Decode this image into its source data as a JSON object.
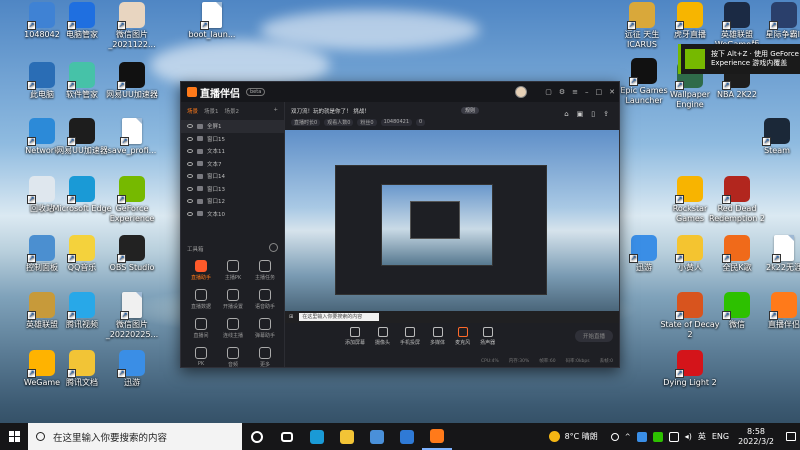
{
  "desktop": {
    "left_icons": [
      {
        "label": "1048042",
        "color": "#3f82d4"
      },
      {
        "label": "电脑管家",
        "color": "#1f6fe0"
      },
      {
        "label": "微信图片_2021122...",
        "color": "#e8d5c0"
      },
      {
        "label": "boot_laun...",
        "color": "#ffffff"
      },
      {
        "label": "此电脑",
        "color": "#2a6db5"
      },
      {
        "label": "软件管家",
        "color": "#46c2a8"
      },
      {
        "label": "网易UU加速器",
        "color": "#111111"
      },
      {
        "label": "Network",
        "color": "#2c8ad8"
      },
      {
        "label": "网易UU加速器",
        "color": "#1d1d1d"
      },
      {
        "label": "save_profi...",
        "color": "#ffffff"
      },
      {
        "label": "回收站",
        "color": "#dfe7ee"
      },
      {
        "label": "Microsoft Edge",
        "color": "#1a9ad6"
      },
      {
        "label": "GeForce Experience",
        "color": "#76b900"
      },
      {
        "label": "控制面板",
        "color": "#4b8fd0"
      },
      {
        "label": "QQ音乐",
        "color": "#f4d23c"
      },
      {
        "label": "OBS Studio",
        "color": "#222222"
      },
      {
        "label": "英雄联盟",
        "color": "#c79a3a"
      },
      {
        "label": "腾讯视频",
        "color": "#28a8e8"
      },
      {
        "label": "微信图片_20220225...",
        "color": "#f0f0f0"
      },
      {
        "label": "WeGame",
        "color": "#ffb300"
      },
      {
        "label": "腾讯文档",
        "color": "#f2c436"
      },
      {
        "label": "迅游",
        "color": "#3a8ee6"
      }
    ],
    "right_icons": [
      {
        "label": "远征 天生ICARUS",
        "color": "#d9a83a"
      },
      {
        "label": "虎牙直播",
        "color": "#f7b500"
      },
      {
        "label": "英雄联盟WeGame版",
        "color": "#1b2a44"
      },
      {
        "label": "星际争霸II",
        "color": "#2a3f6b"
      },
      {
        "label": "Epic Games Launcher",
        "color": "#111111"
      },
      {
        "label": "Wallpaper Engine",
        "color": "#2f6b4a"
      },
      {
        "label": "NBA 2K22",
        "color": "#1d1d1d"
      },
      {
        "label": "Steam",
        "color": "#1b2838"
      },
      {
        "label": "Rockstar Games",
        "color": "#f8b400"
      },
      {
        "label": "Red Dead Redemption 2",
        "color": "#b2261e"
      },
      {
        "label": "迅游",
        "color": "#3a8ee6"
      },
      {
        "label": "小黄人",
        "color": "#f4c430"
      },
      {
        "label": "全民K歌",
        "color": "#f06a1a"
      },
      {
        "label": "2k22无涯",
        "color": "#ffffff"
      },
      {
        "label": "State of Decay 2",
        "color": "#d8541e"
      },
      {
        "label": "微信",
        "color": "#2dc100"
      },
      {
        "label": "直播伴侣",
        "color": "#ff7a1a"
      },
      {
        "label": "Dying Light 2",
        "color": "#d4141a"
      }
    ]
  },
  "geforce_popup": {
    "text": "按下 Alt+Z · 使用 GeForce Experience 游戏内覆盖"
  },
  "app": {
    "title": "直播伴侣",
    "version": "beta",
    "source_tabs": [
      "场景",
      "场景1",
      "场景2"
    ],
    "sources": [
      {
        "name": "全屏1"
      },
      {
        "name": "窗口15"
      },
      {
        "name": "文本11"
      },
      {
        "name": "文本7"
      },
      {
        "name": "窗口14"
      },
      {
        "name": "窗口13"
      },
      {
        "name": "窗口12"
      },
      {
        "name": "文本10"
      }
    ],
    "tools_header": "工具箱",
    "tools": [
      {
        "label": "直播助手"
      },
      {
        "label": "主播PK"
      },
      {
        "label": "主播任务"
      },
      {
        "label": "直播数据"
      },
      {
        "label": "开播设置"
      },
      {
        "label": "语音助手"
      },
      {
        "label": "直播间"
      },
      {
        "label": "连线主播"
      },
      {
        "label": "弹幕助手"
      },
      {
        "label": "PK"
      },
      {
        "label": "音频"
      },
      {
        "label": "更多"
      }
    ],
    "notice": "双刀流！玩的就是你了！ 挑战！",
    "notice_button": "规则",
    "stats": [
      "直播时长0",
      "观看人数0",
      "粉丝0",
      "10480421",
      "0"
    ],
    "bottom_buttons": [
      "添加屏幕",
      "摄像头",
      "手机投屏",
      "多媒体",
      "麦克风",
      "扬声器"
    ],
    "go_live": "开始直播",
    "status_items": [
      "CPU:4%",
      "内存:30%",
      "帧率:60",
      "码率:0kbps",
      "丢帧:0"
    ],
    "preview_search": "在这里输入你要搜索的内容"
  },
  "taskbar": {
    "search_placeholder": "在这里输入你要搜索的内容",
    "apps": [
      {
        "name": "task-view",
        "color": "#ffffff"
      },
      {
        "name": "edge",
        "color": "#1a9ad6"
      },
      {
        "name": "file-explorer",
        "color": "#f2c436"
      },
      {
        "name": "store",
        "color": "#4a90d9"
      },
      {
        "name": "mail",
        "color": "#2f7ad6"
      },
      {
        "name": "live-companion",
        "color": "#ff7a1a"
      }
    ],
    "weather": "8°C 晴朗",
    "input_method": "英",
    "lang": "ENG",
    "time": "8:58",
    "date": "2022/3/2"
  }
}
